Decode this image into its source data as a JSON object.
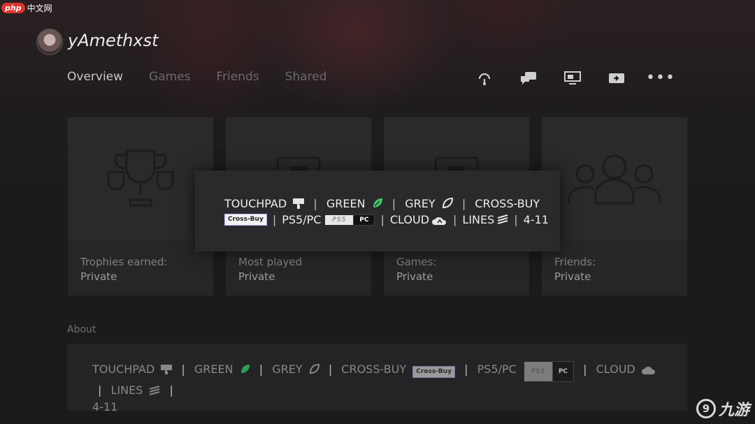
{
  "watermarks": {
    "top_left_badge": "php",
    "top_left_text": "中文网",
    "bottom_right_text": "九游"
  },
  "profile": {
    "username": "yAmethxst"
  },
  "tabs": [
    {
      "label": "Overview",
      "active": true
    },
    {
      "label": "Games",
      "active": false
    },
    {
      "label": "Friends",
      "active": false
    },
    {
      "label": "Shared",
      "active": false
    }
  ],
  "toolbar": {
    "icons": [
      "headset-icon",
      "chat-icon",
      "share-screen-icon",
      "remote-play-icon",
      "more-icon"
    ],
    "more_label": "•••"
  },
  "tiles": [
    {
      "label": "Trophies earned:",
      "value": "Private",
      "icon": "trophy-icon"
    },
    {
      "label": "Most played",
      "value": "Private",
      "icon": "game-case-icon"
    },
    {
      "label": "Games:",
      "value": "Private",
      "icon": "game-case-icon"
    },
    {
      "label": "Friends:",
      "value": "Private",
      "icon": "friends-icon"
    }
  ],
  "overlay": {
    "touchpad": "TOUCHPAD",
    "green": "GREEN",
    "grey": "GREY",
    "crossbuy": "CROSS-BUY",
    "crossbuy_badge": "Cross-Buy",
    "ps5pc": "PS5/PC",
    "ps5_badge": "PS5",
    "pc_badge": "PC",
    "cloud": "CLOUD",
    "lines": "LINES",
    "range": "4-11",
    "separator": "|"
  },
  "about": {
    "label": "About",
    "line1": "TOUCHPAD",
    "green": "GREEN",
    "grey": "GREY",
    "crossbuy": "CROSS-BUY",
    "crossbuy_badge": "Cross-Buy",
    "ps5pc": "PS5/PC",
    "ps5_badge": "PS5",
    "pc_badge": "PC",
    "cloud": "CLOUD",
    "lines": "LINES",
    "range": "4-11"
  },
  "colors": {
    "background": "#1b1b1d",
    "tile": "#262628",
    "overlay": "#2a2a2c",
    "green_accent": "#3fcf6a"
  }
}
